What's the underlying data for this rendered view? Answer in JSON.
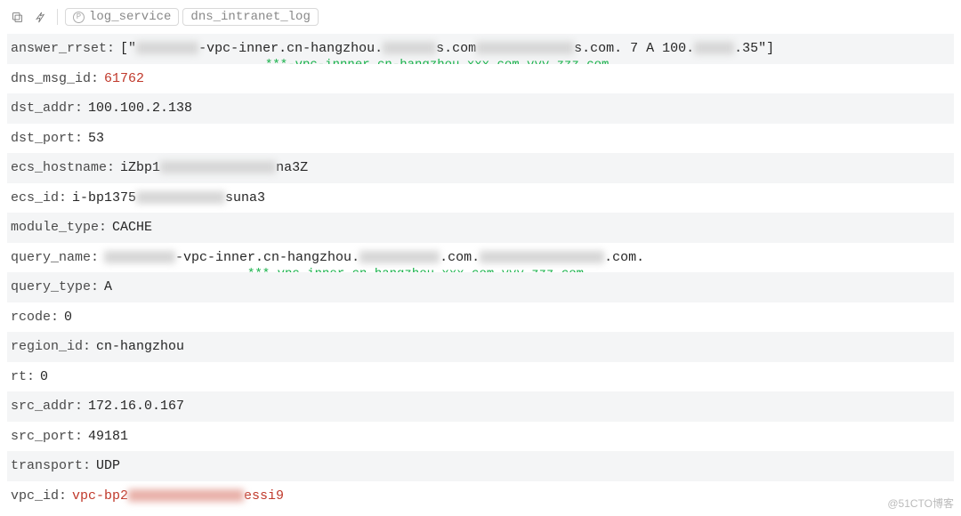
{
  "toolbar": {
    "tag1_letter": "P",
    "tag1_label": "log_service",
    "tag2_label": "dns_intranet_log"
  },
  "rows": {
    "answer_rrset": {
      "key": "answer_rrset",
      "prefix": "[\"",
      "seg1": "-vpc-inner.cn-hangzhou.",
      "seg2": "s.com",
      "seg3": "s.com. 7 A 100.",
      "seg4": ".35\"]",
      "annotation": "***-vpc-innner.cn-hangzhou.xxx.com.yyy.zzz.com"
    },
    "dns_msg_id": {
      "key": "dns_msg_id",
      "value": "61762"
    },
    "dst_addr": {
      "key": "dst_addr",
      "value": "100.100.2.138"
    },
    "dst_port": {
      "key": "dst_port",
      "value": "53"
    },
    "ecs_hostname": {
      "key": "ecs_hostname",
      "pre": "iZbp1",
      "post": "na3Z"
    },
    "ecs_id": {
      "key": "ecs_id",
      "pre": "i-bp1375",
      "post": "suna3"
    },
    "module_type": {
      "key": "module_type",
      "value": "CACHE"
    },
    "query_name": {
      "key": "query_name",
      "seg1": "-vpc-inner.cn-hangzhou.",
      "seg2": ".com.",
      "seg3": ".com.",
      "annotation": "***-vpc-inner.cn-hangzhou.xxx.com.yyy.zzz.com"
    },
    "query_type": {
      "key": "query_type",
      "value": "A"
    },
    "rcode": {
      "key": "rcode",
      "value": "0"
    },
    "region_id": {
      "key": "region_id",
      "value": "cn-hangzhou"
    },
    "rt": {
      "key": "rt",
      "value": "0"
    },
    "src_addr": {
      "key": "src_addr",
      "value": "172.16.0.167"
    },
    "src_port": {
      "key": "src_port",
      "value": "49181"
    },
    "transport": {
      "key": "transport",
      "value": "UDP"
    },
    "vpc_id": {
      "key": "vpc_id",
      "pre": "vpc-bp2",
      "post": "essi9"
    }
  },
  "watermark": "@51CTO博客"
}
